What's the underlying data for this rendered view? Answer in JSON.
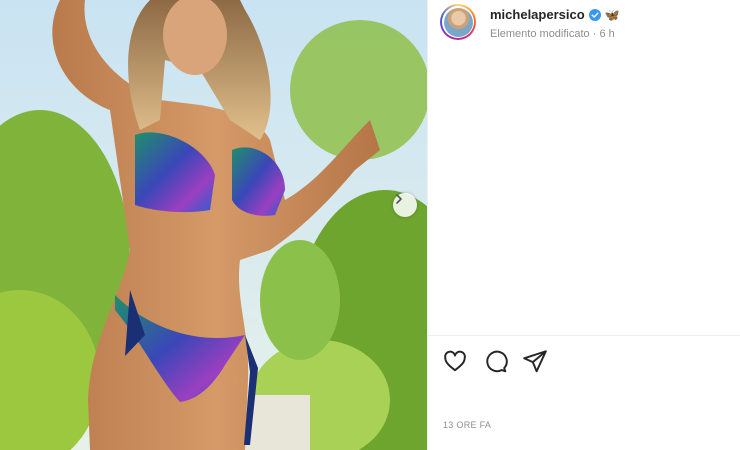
{
  "post": {
    "username": "michelapersico",
    "status": "Elemento modificato",
    "separator": " · ",
    "age": "6 h",
    "time_label": "13 ORE FA",
    "emoji": "🦋"
  },
  "icons": {
    "like": "heart-icon",
    "comment": "comment-icon",
    "share": "send-icon",
    "verified": "verified-badge-icon",
    "next": "chevron-right-icon"
  },
  "colors": {
    "verified": "#3897f0",
    "text": "#262626",
    "muted": "#8e8e8e"
  }
}
